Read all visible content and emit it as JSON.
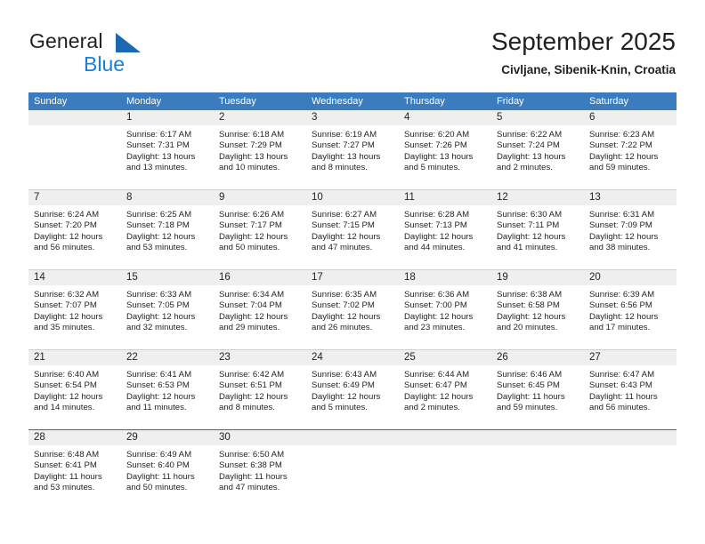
{
  "brand": {
    "general": "General",
    "blue": "Blue",
    "mark": "triangle-logo"
  },
  "header": {
    "title": "September 2025",
    "subtitle": "Civljane, Sibenik-Knin, Croatia"
  },
  "colors": {
    "header_blue": "#3a7cbe",
    "brand_blue": "#1b7fd4",
    "mark_blue": "#1b68b3",
    "band_gray": "#efefef",
    "grid_line": "#cfcfcf"
  },
  "weekdays": [
    "Sunday",
    "Monday",
    "Tuesday",
    "Wednesday",
    "Thursday",
    "Friday",
    "Saturday"
  ],
  "labels": {
    "sunrise_prefix": "Sunrise:",
    "sunset_prefix": "Sunset:",
    "daylight_prefix": "Daylight:"
  },
  "weeks": [
    [
      {
        "day": "",
        "sunrise": "",
        "sunset": "",
        "daylight_1": "",
        "daylight_2": ""
      },
      {
        "day": "1",
        "sunrise": "Sunrise: 6:17 AM",
        "sunset": "Sunset: 7:31 PM",
        "daylight_1": "Daylight: 13 hours",
        "daylight_2": "and 13 minutes."
      },
      {
        "day": "2",
        "sunrise": "Sunrise: 6:18 AM",
        "sunset": "Sunset: 7:29 PM",
        "daylight_1": "Daylight: 13 hours",
        "daylight_2": "and 10 minutes."
      },
      {
        "day": "3",
        "sunrise": "Sunrise: 6:19 AM",
        "sunset": "Sunset: 7:27 PM",
        "daylight_1": "Daylight: 13 hours",
        "daylight_2": "and 8 minutes."
      },
      {
        "day": "4",
        "sunrise": "Sunrise: 6:20 AM",
        "sunset": "Sunset: 7:26 PM",
        "daylight_1": "Daylight: 13 hours",
        "daylight_2": "and 5 minutes."
      },
      {
        "day": "5",
        "sunrise": "Sunrise: 6:22 AM",
        "sunset": "Sunset: 7:24 PM",
        "daylight_1": "Daylight: 13 hours",
        "daylight_2": "and 2 minutes."
      },
      {
        "day": "6",
        "sunrise": "Sunrise: 6:23 AM",
        "sunset": "Sunset: 7:22 PM",
        "daylight_1": "Daylight: 12 hours",
        "daylight_2": "and 59 minutes."
      }
    ],
    [
      {
        "day": "7",
        "sunrise": "Sunrise: 6:24 AM",
        "sunset": "Sunset: 7:20 PM",
        "daylight_1": "Daylight: 12 hours",
        "daylight_2": "and 56 minutes."
      },
      {
        "day": "8",
        "sunrise": "Sunrise: 6:25 AM",
        "sunset": "Sunset: 7:18 PM",
        "daylight_1": "Daylight: 12 hours",
        "daylight_2": "and 53 minutes."
      },
      {
        "day": "9",
        "sunrise": "Sunrise: 6:26 AM",
        "sunset": "Sunset: 7:17 PM",
        "daylight_1": "Daylight: 12 hours",
        "daylight_2": "and 50 minutes."
      },
      {
        "day": "10",
        "sunrise": "Sunrise: 6:27 AM",
        "sunset": "Sunset: 7:15 PM",
        "daylight_1": "Daylight: 12 hours",
        "daylight_2": "and 47 minutes."
      },
      {
        "day": "11",
        "sunrise": "Sunrise: 6:28 AM",
        "sunset": "Sunset: 7:13 PM",
        "daylight_1": "Daylight: 12 hours",
        "daylight_2": "and 44 minutes."
      },
      {
        "day": "12",
        "sunrise": "Sunrise: 6:30 AM",
        "sunset": "Sunset: 7:11 PM",
        "daylight_1": "Daylight: 12 hours",
        "daylight_2": "and 41 minutes."
      },
      {
        "day": "13",
        "sunrise": "Sunrise: 6:31 AM",
        "sunset": "Sunset: 7:09 PM",
        "daylight_1": "Daylight: 12 hours",
        "daylight_2": "and 38 minutes."
      }
    ],
    [
      {
        "day": "14",
        "sunrise": "Sunrise: 6:32 AM",
        "sunset": "Sunset: 7:07 PM",
        "daylight_1": "Daylight: 12 hours",
        "daylight_2": "and 35 minutes."
      },
      {
        "day": "15",
        "sunrise": "Sunrise: 6:33 AM",
        "sunset": "Sunset: 7:05 PM",
        "daylight_1": "Daylight: 12 hours",
        "daylight_2": "and 32 minutes."
      },
      {
        "day": "16",
        "sunrise": "Sunrise: 6:34 AM",
        "sunset": "Sunset: 7:04 PM",
        "daylight_1": "Daylight: 12 hours",
        "daylight_2": "and 29 minutes."
      },
      {
        "day": "17",
        "sunrise": "Sunrise: 6:35 AM",
        "sunset": "Sunset: 7:02 PM",
        "daylight_1": "Daylight: 12 hours",
        "daylight_2": "and 26 minutes."
      },
      {
        "day": "18",
        "sunrise": "Sunrise: 6:36 AM",
        "sunset": "Sunset: 7:00 PM",
        "daylight_1": "Daylight: 12 hours",
        "daylight_2": "and 23 minutes."
      },
      {
        "day": "19",
        "sunrise": "Sunrise: 6:38 AM",
        "sunset": "Sunset: 6:58 PM",
        "daylight_1": "Daylight: 12 hours",
        "daylight_2": "and 20 minutes."
      },
      {
        "day": "20",
        "sunrise": "Sunrise: 6:39 AM",
        "sunset": "Sunset: 6:56 PM",
        "daylight_1": "Daylight: 12 hours",
        "daylight_2": "and 17 minutes."
      }
    ],
    [
      {
        "day": "21",
        "sunrise": "Sunrise: 6:40 AM",
        "sunset": "Sunset: 6:54 PM",
        "daylight_1": "Daylight: 12 hours",
        "daylight_2": "and 14 minutes."
      },
      {
        "day": "22",
        "sunrise": "Sunrise: 6:41 AM",
        "sunset": "Sunset: 6:53 PM",
        "daylight_1": "Daylight: 12 hours",
        "daylight_2": "and 11 minutes."
      },
      {
        "day": "23",
        "sunrise": "Sunrise: 6:42 AM",
        "sunset": "Sunset: 6:51 PM",
        "daylight_1": "Daylight: 12 hours",
        "daylight_2": "and 8 minutes."
      },
      {
        "day": "24",
        "sunrise": "Sunrise: 6:43 AM",
        "sunset": "Sunset: 6:49 PM",
        "daylight_1": "Daylight: 12 hours",
        "daylight_2": "and 5 minutes."
      },
      {
        "day": "25",
        "sunrise": "Sunrise: 6:44 AM",
        "sunset": "Sunset: 6:47 PM",
        "daylight_1": "Daylight: 12 hours",
        "daylight_2": "and 2 minutes."
      },
      {
        "day": "26",
        "sunrise": "Sunrise: 6:46 AM",
        "sunset": "Sunset: 6:45 PM",
        "daylight_1": "Daylight: 11 hours",
        "daylight_2": "and 59 minutes."
      },
      {
        "day": "27",
        "sunrise": "Sunrise: 6:47 AM",
        "sunset": "Sunset: 6:43 PM",
        "daylight_1": "Daylight: 11 hours",
        "daylight_2": "and 56 minutes."
      }
    ],
    [
      {
        "day": "28",
        "sunrise": "Sunrise: 6:48 AM",
        "sunset": "Sunset: 6:41 PM",
        "daylight_1": "Daylight: 11 hours",
        "daylight_2": "and 53 minutes."
      },
      {
        "day": "29",
        "sunrise": "Sunrise: 6:49 AM",
        "sunset": "Sunset: 6:40 PM",
        "daylight_1": "Daylight: 11 hours",
        "daylight_2": "and 50 minutes."
      },
      {
        "day": "30",
        "sunrise": "Sunrise: 6:50 AM",
        "sunset": "Sunset: 6:38 PM",
        "daylight_1": "Daylight: 11 hours",
        "daylight_2": "and 47 minutes."
      },
      {
        "day": "",
        "sunrise": "",
        "sunset": "",
        "daylight_1": "",
        "daylight_2": ""
      },
      {
        "day": "",
        "sunrise": "",
        "sunset": "",
        "daylight_1": "",
        "daylight_2": ""
      },
      {
        "day": "",
        "sunrise": "",
        "sunset": "",
        "daylight_1": "",
        "daylight_2": ""
      },
      {
        "day": "",
        "sunrise": "",
        "sunset": "",
        "daylight_1": "",
        "daylight_2": ""
      }
    ]
  ]
}
